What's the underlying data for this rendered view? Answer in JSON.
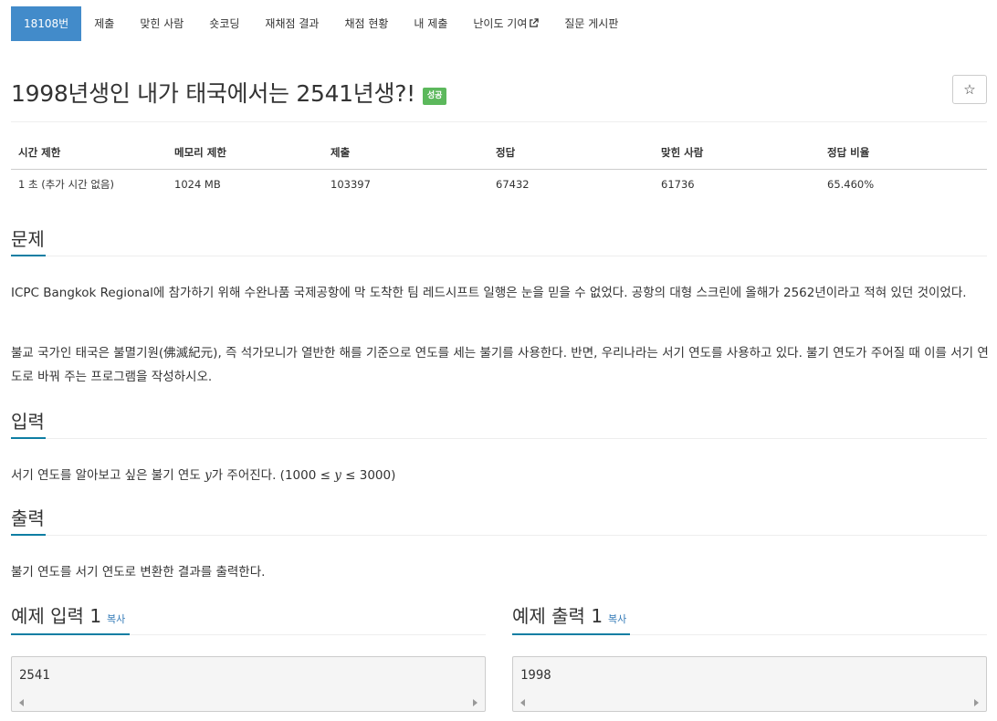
{
  "nav": {
    "items": [
      "18108번",
      "제출",
      "맞힌 사람",
      "숏코딩",
      "재채점 결과",
      "채점 현황",
      "내 제출",
      "난이도 기여",
      "질문 게시판"
    ],
    "external_icon": "external-link-icon"
  },
  "problem": {
    "title": "1998년생인 내가 태국에서는 2541년생?!",
    "badge": "성공",
    "star": "☆"
  },
  "info": {
    "headers": [
      "시간 제한",
      "메모리 제한",
      "제출",
      "정답",
      "맞힌 사람",
      "정답 비율"
    ],
    "values": [
      "1 초 (추가 시간 없음)",
      "1024 MB",
      "103397",
      "67432",
      "61736",
      "65.460%"
    ]
  },
  "sections": {
    "problem_head": "문제",
    "problem_p1": "ICPC Bangkok Regional에 참가하기 위해 수완나품 국제공항에 막 도착한 팀 레드시프트 일행은 눈을 믿을 수 없었다. 공항의 대형 스크린에 올해가 2562년이라고 적혀 있던 것이었다.",
    "problem_p2": "불교 국가인 태국은 불멸기원(佛滅紀元), 즉 석가모니가 열반한 해를 기준으로 연도를 세는 불기를 사용한다. 반면, 우리나라는 서기 연도를 사용하고 있다. 불기 연도가 주어질 때 이를 서기 연도로 바꿔 주는 프로그램을 작성하시오.",
    "input_head": "입력",
    "input_p_before": "서기 연도를 알아보고 싶은 불기 연도 ",
    "input_var": "y",
    "input_p_mid": "가 주어진다. (1000 ≤ ",
    "input_var2": "y",
    "input_p_after": " ≤ 3000)",
    "output_head": "출력",
    "output_p": "불기 연도를 서기 연도로 변환한 결과를 출력한다."
  },
  "samples": {
    "input_head": "예제 입력 1",
    "output_head": "예제 출력 1",
    "copy": "복사",
    "input_value": "2541",
    "output_value": "1998"
  }
}
